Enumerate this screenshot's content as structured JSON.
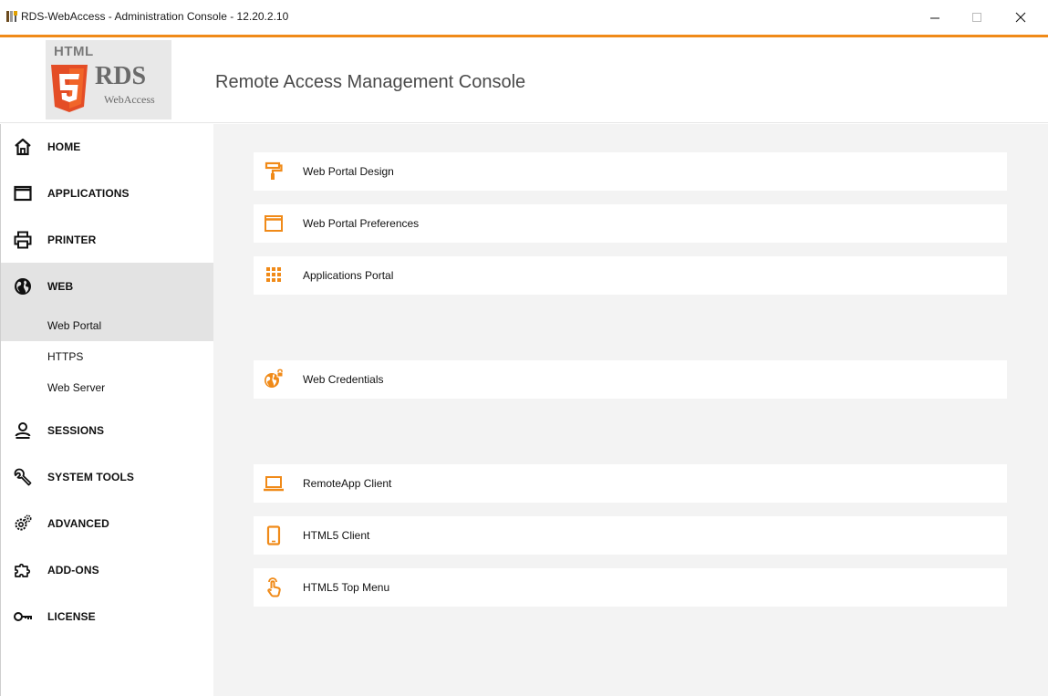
{
  "window": {
    "title": "RDS-WebAccess - Administration Console - 12.20.2.10"
  },
  "header": {
    "logo_top": "HTML",
    "logo_brand": "RDS",
    "logo_sub": "WebAccess",
    "console_title": "Remote Access Management Console"
  },
  "sidebar": {
    "items": [
      {
        "label": "HOME",
        "icon": "home-icon"
      },
      {
        "label": "APPLICATIONS",
        "icon": "window-icon"
      },
      {
        "label": "PRINTER",
        "icon": "printer-icon"
      },
      {
        "label": "WEB",
        "icon": "globe-icon",
        "active": true
      },
      {
        "label": "SESSIONS",
        "icon": "user-icon"
      },
      {
        "label": "SYSTEM TOOLS",
        "icon": "wrench-icon"
      },
      {
        "label": "ADVANCED",
        "icon": "gears-icon"
      },
      {
        "label": "ADD-ONS",
        "icon": "puzzle-icon"
      },
      {
        "label": "LICENSE",
        "icon": "key-icon"
      }
    ],
    "web_subitems": [
      {
        "label": "Web Portal",
        "active": true
      },
      {
        "label": "HTTPS"
      },
      {
        "label": "Web Server"
      }
    ]
  },
  "main": {
    "cards": [
      {
        "label": "Web Portal Design",
        "icon": "paint-roller-icon"
      },
      {
        "label": "Web Portal Preferences",
        "icon": "window-icon"
      },
      {
        "label": "Applications Portal",
        "icon": "grid-icon"
      },
      {
        "label": "Web Credentials",
        "icon": "globe-lock-icon"
      },
      {
        "label": "RemoteApp Client",
        "icon": "laptop-icon"
      },
      {
        "label": "HTML5 Client",
        "icon": "tablet-icon"
      },
      {
        "label": "HTML5 Top Menu",
        "icon": "touch-icon"
      }
    ]
  },
  "colors": {
    "accent": "#f08a18",
    "sidebar_active": "#e3e3e3",
    "main_bg": "#f3f3f3"
  }
}
